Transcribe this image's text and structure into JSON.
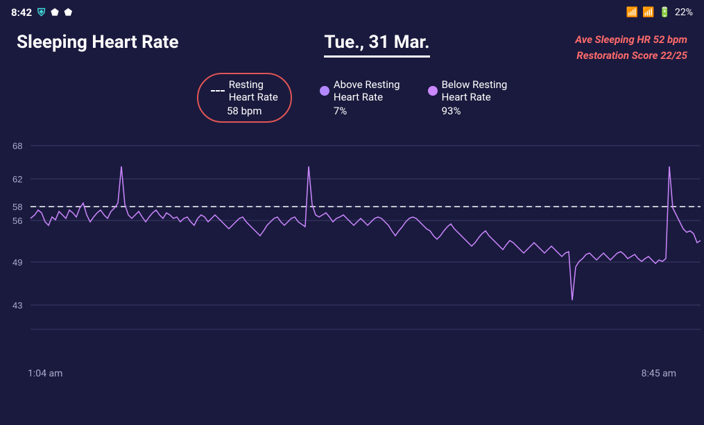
{
  "statusBar": {
    "time": "8:42",
    "battery": "22%",
    "icons": [
      "shield",
      "m1",
      "m2"
    ]
  },
  "header": {
    "title": "Sleeping Heart Rate",
    "date": "Tue., 31 Mar.",
    "aveSleepingHR": "Ave Sleeping HR 52 bpm",
    "restorationScore": "Restoration Score 22/25"
  },
  "legend": {
    "resting": {
      "label": "Resting\nHeart Rate",
      "value": "58 bpm"
    },
    "above": {
      "label": "Above Resting\nHeart Rate",
      "value": "7%",
      "color": "#b388ff"
    },
    "below": {
      "label": "Below Resting\nHeart Rate",
      "value": "93%",
      "color": "#cc88ff"
    }
  },
  "yAxis": {
    "labels": [
      "68",
      "62",
      "58",
      "56",
      "49",
      "43"
    ]
  },
  "xAxis": {
    "start": "1:04 am",
    "end": "8:45 am"
  }
}
